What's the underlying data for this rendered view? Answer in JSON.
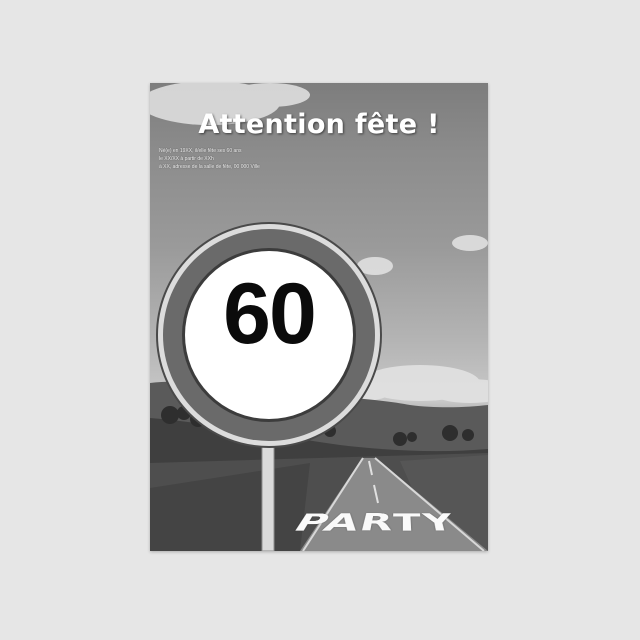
{
  "poster": {
    "headline": "Attention fête !",
    "details": [
      "Né(e) en 19XX, il/elle fête ses 60 ans",
      "le XX/XX à partir de XXh",
      "à XX, adresse de la salle de fête, 00 000 Ville"
    ],
    "sign_number": "60",
    "road_word": "PARTY"
  },
  "colors": {
    "background": "#e6e6e6",
    "sign_ring": "#6a6a6a",
    "sign_face": "#ffffff",
    "sign_text": "#0b0b0b"
  }
}
